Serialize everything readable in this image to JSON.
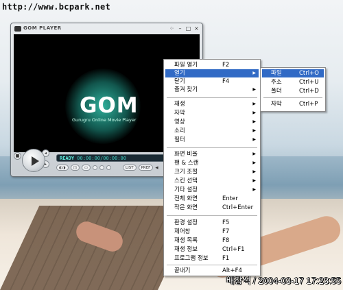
{
  "watermark": "http://www.bcpark.net",
  "photo_stamp": "배창석 / 2004-03-17 17:23:55",
  "player": {
    "title": "GOM PLAYER",
    "logo": "GOM",
    "tagline": "Gurugru Online Movie Player",
    "status": "READY",
    "time": "00:00:00/00:00:00",
    "buttons": [
      "LIST",
      "PREF"
    ]
  },
  "colors": {
    "menu_highlight": "#316ac5",
    "lcd_bg": "#1a2a33"
  },
  "context_menu": {
    "items": [
      {
        "label": "파일 열기",
        "shortcut": "F2",
        "submenu": false
      },
      {
        "label": "열기",
        "shortcut": "",
        "submenu": true,
        "highlighted": true
      },
      {
        "label": "닫기",
        "shortcut": "F4",
        "submenu": false
      },
      {
        "label": "즐겨 찾기",
        "shortcut": "",
        "submenu": true
      },
      {
        "label": "재생",
        "shortcut": "",
        "submenu": true
      },
      {
        "label": "자막",
        "shortcut": "",
        "submenu": true
      },
      {
        "label": "영상",
        "shortcut": "",
        "submenu": true
      },
      {
        "label": "소리",
        "shortcut": "",
        "submenu": true
      },
      {
        "label": "필터",
        "shortcut": "",
        "submenu": true
      },
      {
        "label": "화면 비율",
        "shortcut": "",
        "submenu": true
      },
      {
        "label": "팬 & 스캔",
        "shortcut": "",
        "submenu": true
      },
      {
        "label": "크기 조절",
        "shortcut": "",
        "submenu": true
      },
      {
        "label": "스킨 선택",
        "shortcut": "",
        "submenu": true
      },
      {
        "label": "기타 설정",
        "shortcut": "",
        "submenu": true
      },
      {
        "label": "전체 화면",
        "shortcut": "Enter",
        "submenu": false
      },
      {
        "label": "작은 화면",
        "shortcut": "Ctrl+Enter",
        "submenu": false
      },
      {
        "label": "환경 설정",
        "shortcut": "F5",
        "submenu": false
      },
      {
        "label": "제어창",
        "shortcut": "F7",
        "submenu": false
      },
      {
        "label": "재생 목록",
        "shortcut": "F8",
        "submenu": false
      },
      {
        "label": "재생 정보",
        "shortcut": "Ctrl+F1",
        "submenu": false
      },
      {
        "label": "프로그램 정보",
        "shortcut": "F1",
        "submenu": false
      },
      {
        "label": "끝내기",
        "shortcut": "Alt+F4",
        "submenu": false
      }
    ]
  },
  "open_submenu": {
    "items": [
      {
        "label": "파일",
        "shortcut": "Ctrl+O",
        "highlighted": true
      },
      {
        "label": "주소",
        "shortcut": "Ctrl+U"
      },
      {
        "label": "폴더",
        "shortcut": "Ctrl+D"
      },
      {
        "label": "자막",
        "shortcut": "Ctrl+P"
      }
    ]
  }
}
